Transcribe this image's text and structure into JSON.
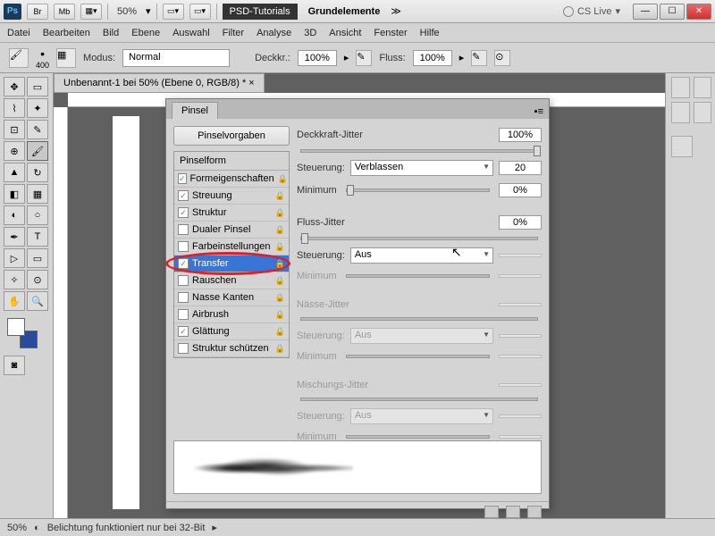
{
  "titlebar": {
    "logo": "Ps",
    "btns": [
      "Br",
      "Mb"
    ],
    "zoom": "50%",
    "title1": "PSD-Tutorials",
    "title2": "Grundelemente",
    "cslive": "CS Live"
  },
  "menu": [
    "Datei",
    "Bearbeiten",
    "Bild",
    "Ebene",
    "Auswahl",
    "Filter",
    "Analyse",
    "3D",
    "Ansicht",
    "Fenster",
    "Hilfe"
  ],
  "options": {
    "brush_size": "400",
    "mode_label": "Modus:",
    "mode_value": "Normal",
    "opacity_label": "Deckkr.:",
    "opacity_value": "100%",
    "flow_label": "Fluss:",
    "flow_value": "100%"
  },
  "doc_tab": "Unbenannt-1 bei 50% (Ebene 0, RGB/8) * ×",
  "panel": {
    "tab": "Pinsel",
    "presets_btn": "Pinselvorgaben",
    "header": "Pinselform",
    "items": [
      {
        "label": "Formeigenschaften",
        "chk": true
      },
      {
        "label": "Streuung",
        "chk": true
      },
      {
        "label": "Struktur",
        "chk": true
      },
      {
        "label": "Dualer Pinsel",
        "chk": false
      },
      {
        "label": "Farbeinstellungen",
        "chk": false
      },
      {
        "label": "Transfer",
        "chk": true,
        "sel": true
      },
      {
        "label": "Rauschen",
        "chk": false
      },
      {
        "label": "Nasse Kanten",
        "chk": false
      },
      {
        "label": "Airbrush",
        "chk": false
      },
      {
        "label": "Glättung",
        "chk": true
      },
      {
        "label": "Struktur schützen",
        "chk": false
      }
    ],
    "r": {
      "deckkraft_jitter": "Deckkraft-Jitter",
      "deckkraft_val": "100%",
      "steuerung": "Steuerung:",
      "verblassen": "Verblassen",
      "verblassen_val": "20",
      "minimum": "Minimum",
      "min_val": "0%",
      "fluss_jitter": "Fluss-Jitter",
      "fluss_val": "0%",
      "aus": "Aus",
      "naesse_jitter": "Nässe-Jitter",
      "mischungs_jitter": "Mischungs-Jitter"
    }
  },
  "status": {
    "zoom": "50%",
    "msg": "Belichtung funktioniert nur bei 32-Bit"
  }
}
